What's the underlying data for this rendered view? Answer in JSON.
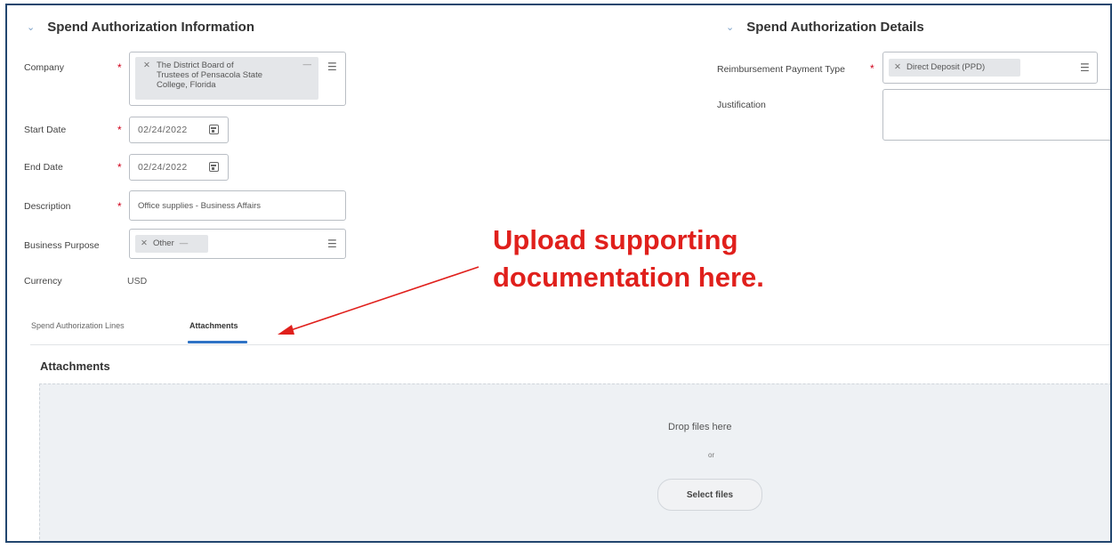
{
  "left_section": {
    "title": "Spend Authorization Information",
    "company": {
      "label": "Company",
      "value_line1": "The District Board of",
      "value_line2": "Trustees of Pensacola State",
      "value_line3": "College, Florida"
    },
    "start_date": {
      "label": "Start Date",
      "value": "02/24/2022"
    },
    "end_date": {
      "label": "End Date",
      "value": "02/24/2022"
    },
    "description": {
      "label": "Description",
      "value": "Office supplies - Business Affairs"
    },
    "business_purpose": {
      "label": "Business Purpose",
      "value": "Other"
    },
    "currency": {
      "label": "Currency",
      "value": "USD"
    },
    "required_mark": "*"
  },
  "right_section": {
    "title": "Spend Authorization Details",
    "reimbursement": {
      "label": "Reimbursement Payment Type",
      "value": "Direct Deposit (PPD)"
    },
    "justification": {
      "label": "Justification",
      "value": ""
    }
  },
  "tabs": [
    {
      "label": "Spend Authorization Lines",
      "active": false
    },
    {
      "label": "Attachments",
      "active": true
    }
  ],
  "attachments": {
    "title": "Attachments",
    "drop_text": "Drop files here",
    "or_text": "or",
    "select_button": "Select files"
  },
  "annotation": {
    "line1": "Upload supporting",
    "line2": "documentation here.",
    "color": "#e0201c"
  },
  "icons": {
    "chevron": "chevron-down-icon",
    "remove": "close-icon",
    "list": "list-icon",
    "calendar": "calendar-icon",
    "more": "more-icon"
  }
}
